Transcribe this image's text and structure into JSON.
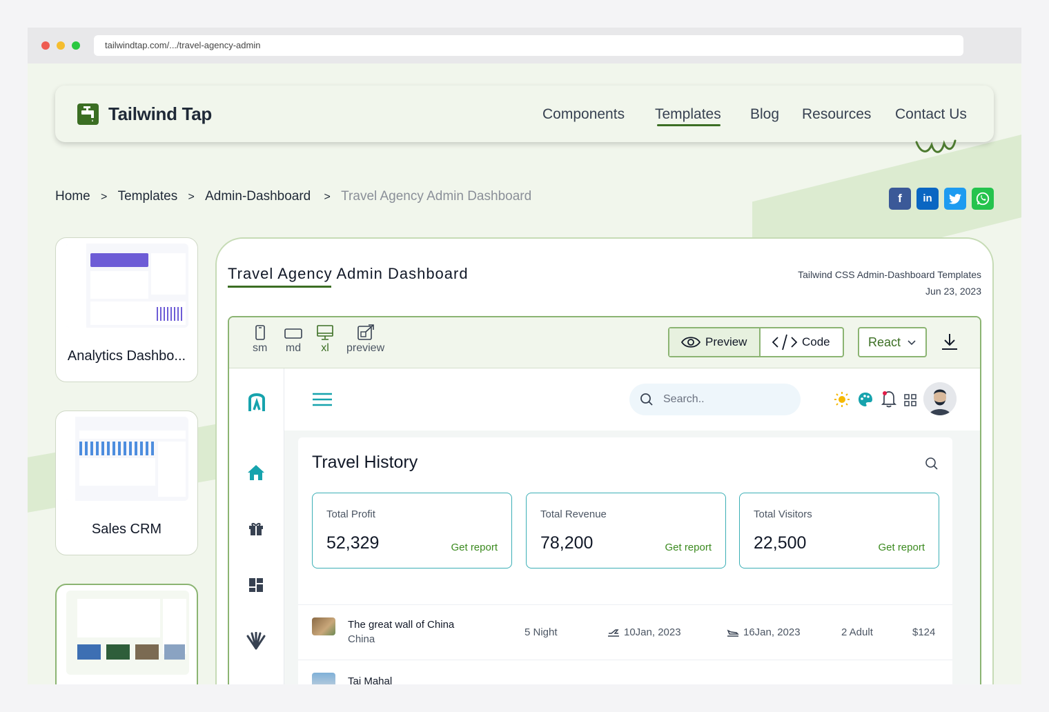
{
  "browser": {
    "url": "tailwindtap.com/.../travel-agency-admin"
  },
  "site": {
    "brand": "Tailwind Tap",
    "nav": [
      "Components",
      "Templates",
      "Blog",
      "Resources",
      "Contact Us"
    ],
    "active_nav": "Templates",
    "accent": "#3b6e23"
  },
  "breadcrumb": {
    "items": [
      "Home",
      "Templates",
      "Admin-Dashboard"
    ],
    "current": "Travel Agency Admin Dashboard"
  },
  "share": [
    "facebook-icon",
    "linkedin-icon",
    "twitter-icon",
    "whatsapp-icon"
  ],
  "related_templates": [
    {
      "label": "Analytics Dashbo..."
    },
    {
      "label": "Sales CRM"
    },
    {
      "label": ""
    }
  ],
  "template": {
    "title": "Travel Agency Admin Dashboard",
    "category": "Tailwind CSS Admin-Dashboard Templates",
    "date": "Jun 23, 2023"
  },
  "toolbar": {
    "viewports": [
      "sm",
      "md",
      "xl",
      "preview"
    ],
    "active_viewport": "xl",
    "preview_label": "Preview",
    "code_label": "Code",
    "framework": "React"
  },
  "preview_app": {
    "search_placeholder": "Search..",
    "panel_title": "Travel History",
    "stats": [
      {
        "title": "Total Profit",
        "value": "52,329",
        "link": "Get report"
      },
      {
        "title": "Total Revenue",
        "value": "78,200",
        "link": "Get report"
      },
      {
        "title": "Total Visitors",
        "value": "22,500",
        "link": "Get report"
      }
    ],
    "trips": [
      {
        "name": "The great wall of China",
        "country": "China",
        "nights": "5 Night",
        "depart": "10Jan, 2023",
        "arrive": "16Jan, 2023",
        "guests": "2 Adult",
        "price": "$124"
      },
      {
        "name": "Taj Mahal",
        "country": "",
        "nights": "",
        "depart": "",
        "arrive": "",
        "guests": "",
        "price": ""
      }
    ],
    "teal": "#16a3ad"
  }
}
